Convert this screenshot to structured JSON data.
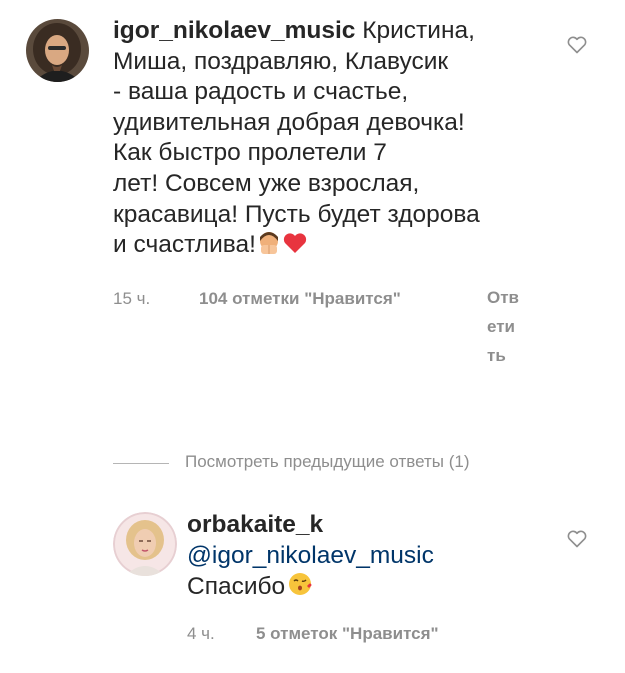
{
  "comments": [
    {
      "username": "igor_nikolaev_music",
      "text_lines": [
        "Кристина,",
        "Миша, поздравляю, Клавусик",
        "- ваша радость и счастье,",
        "удивительная добрая девочка!",
        "Как быстро пролетели 7",
        "лет! Совсем уже взрослая,",
        "красавица! Пусть будет здорова",
        "и счастлива!"
      ],
      "emojis": [
        "face-with-hands-emoji",
        "red-heart-emoji"
      ],
      "time": "15 ч.",
      "likes": "104 отметки \"Нравится\"",
      "reply": "Ответить"
    },
    {
      "username": "orbakaite_k",
      "mention": "@igor_nikolaev_music",
      "text": "Спасибо",
      "emojis": [
        "kissing-face-emoji"
      ],
      "time": "4 ч.",
      "likes": "5 отметок \"Нравится\""
    }
  ],
  "thread": {
    "view_previous_replies": "Посмотреть предыдущие ответы (1)"
  },
  "icons": {
    "like": "heart-outline-icon"
  },
  "colors": {
    "text": "#262626",
    "muted": "#8e8e8e",
    "mention": "#003569",
    "heart": "#e8343f"
  }
}
